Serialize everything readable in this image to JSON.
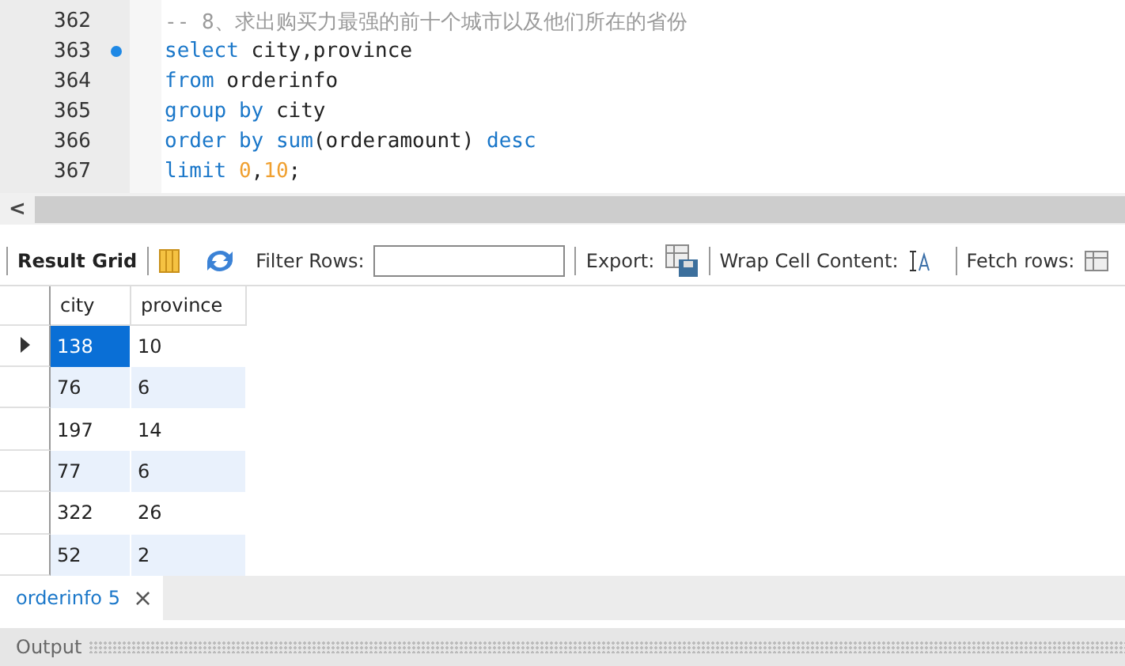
{
  "editor": {
    "lines": [
      {
        "number": "362",
        "marker": false,
        "tokens": [
          {
            "kind": "comment",
            "text": "-- 8、求出购买力最强的前十个城市以及他们所在的省份"
          }
        ]
      },
      {
        "number": "363",
        "marker": true,
        "tokens": [
          {
            "kind": "keyword",
            "text": "select"
          },
          {
            "kind": "plain",
            "text": " city,province"
          }
        ]
      },
      {
        "number": "364",
        "marker": false,
        "tokens": [
          {
            "kind": "keyword",
            "text": "from"
          },
          {
            "kind": "plain",
            "text": " orderinfo"
          }
        ]
      },
      {
        "number": "365",
        "marker": false,
        "tokens": [
          {
            "kind": "keyword",
            "text": "group by"
          },
          {
            "kind": "plain",
            "text": " city"
          }
        ]
      },
      {
        "number": "366",
        "marker": false,
        "tokens": [
          {
            "kind": "keyword",
            "text": "order by sum"
          },
          {
            "kind": "plain",
            "text": "(orderamount) "
          },
          {
            "kind": "keyword",
            "text": "desc"
          }
        ]
      },
      {
        "number": "367",
        "marker": false,
        "tokens": [
          {
            "kind": "keyword",
            "text": "limit"
          },
          {
            "kind": "number",
            "text": " 0"
          },
          {
            "kind": "plain",
            "text": ","
          },
          {
            "kind": "number",
            "text": "10"
          },
          {
            "kind": "plain",
            "text": ";"
          }
        ]
      }
    ]
  },
  "scroll_left": "<",
  "toolbar": {
    "result_grid": "Result Grid",
    "filter_label": "Filter Rows:",
    "export_label": "Export:",
    "wrap_label": "Wrap Cell Content:",
    "fetch_label": "Fetch rows:"
  },
  "table": {
    "columns": [
      "city",
      "province"
    ],
    "rows": [
      {
        "cells": [
          "138",
          "10"
        ],
        "selected": true
      },
      {
        "cells": [
          "76",
          "6"
        ],
        "selected": false
      },
      {
        "cells": [
          "197",
          "14"
        ],
        "selected": false
      },
      {
        "cells": [
          "77",
          "6"
        ],
        "selected": false
      },
      {
        "cells": [
          "322",
          "26"
        ],
        "selected": false
      },
      {
        "cells": [
          "52",
          "2"
        ],
        "selected": false
      }
    ]
  },
  "result_tabs": [
    {
      "label": "orderinfo 5",
      "close": "×",
      "selected": true
    }
  ],
  "output": {
    "label": "Output"
  }
}
